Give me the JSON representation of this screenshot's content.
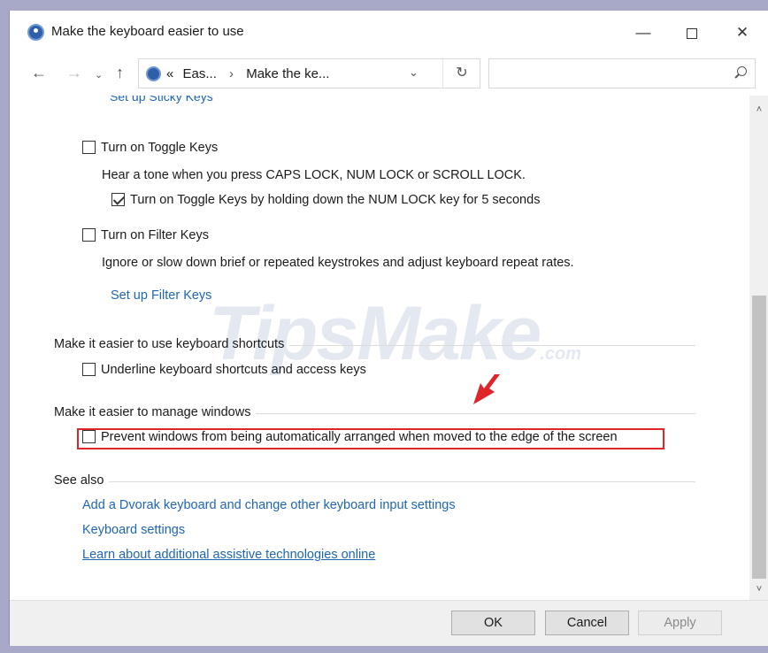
{
  "window": {
    "title": "Make the keyboard easier to use",
    "minimize": "—",
    "close": "✕"
  },
  "nav": {
    "back": "←",
    "forward": "→",
    "recent": "⌄",
    "up": "↑",
    "breadcrumb_prefix": "«",
    "breadcrumb_1": "Eas...",
    "breadcrumb_sep": "›",
    "breadcrumb_2": "Make the ke...",
    "dropdown": "⌄",
    "refresh": "↻",
    "search_placeholder": ""
  },
  "content": {
    "cut_link": "Set up Sticky Keys",
    "toggle_keys": {
      "label": "Turn on Toggle Keys",
      "checked": false,
      "description": "Hear a tone when you press CAPS LOCK, NUM LOCK or SCROLL LOCK.",
      "sub_label": "Turn on Toggle Keys by holding down the NUM LOCK key for 5 seconds",
      "sub_checked": true
    },
    "filter_keys": {
      "label": "Turn on Filter Keys",
      "checked": false,
      "description": "Ignore or slow down brief or repeated keystrokes and adjust keyboard repeat rates.",
      "link": "Set up Filter Keys"
    },
    "shortcuts_section": {
      "heading": "Make it easier to use keyboard shortcuts",
      "option": "Underline keyboard shortcuts and access keys",
      "checked": false
    },
    "windows_section": {
      "heading": "Make it easier to manage windows",
      "option": "Prevent windows from being automatically arranged when moved to the edge of the screen",
      "checked": false
    },
    "see_also": {
      "heading": "See also",
      "links": [
        "Add a Dvorak keyboard and change other keyboard input settings",
        "Keyboard settings",
        "Learn about additional assistive technologies online"
      ]
    },
    "watermark": "TipsMake",
    "watermark_suffix": ".com"
  },
  "scrollbar": {
    "up": "˄",
    "down": "˅"
  },
  "footer": {
    "ok": "OK",
    "cancel": "Cancel",
    "apply": "Apply"
  },
  "colors": {
    "link": "#1e66b4",
    "highlight": "#e0252a",
    "accent": "#2f5fa8"
  }
}
